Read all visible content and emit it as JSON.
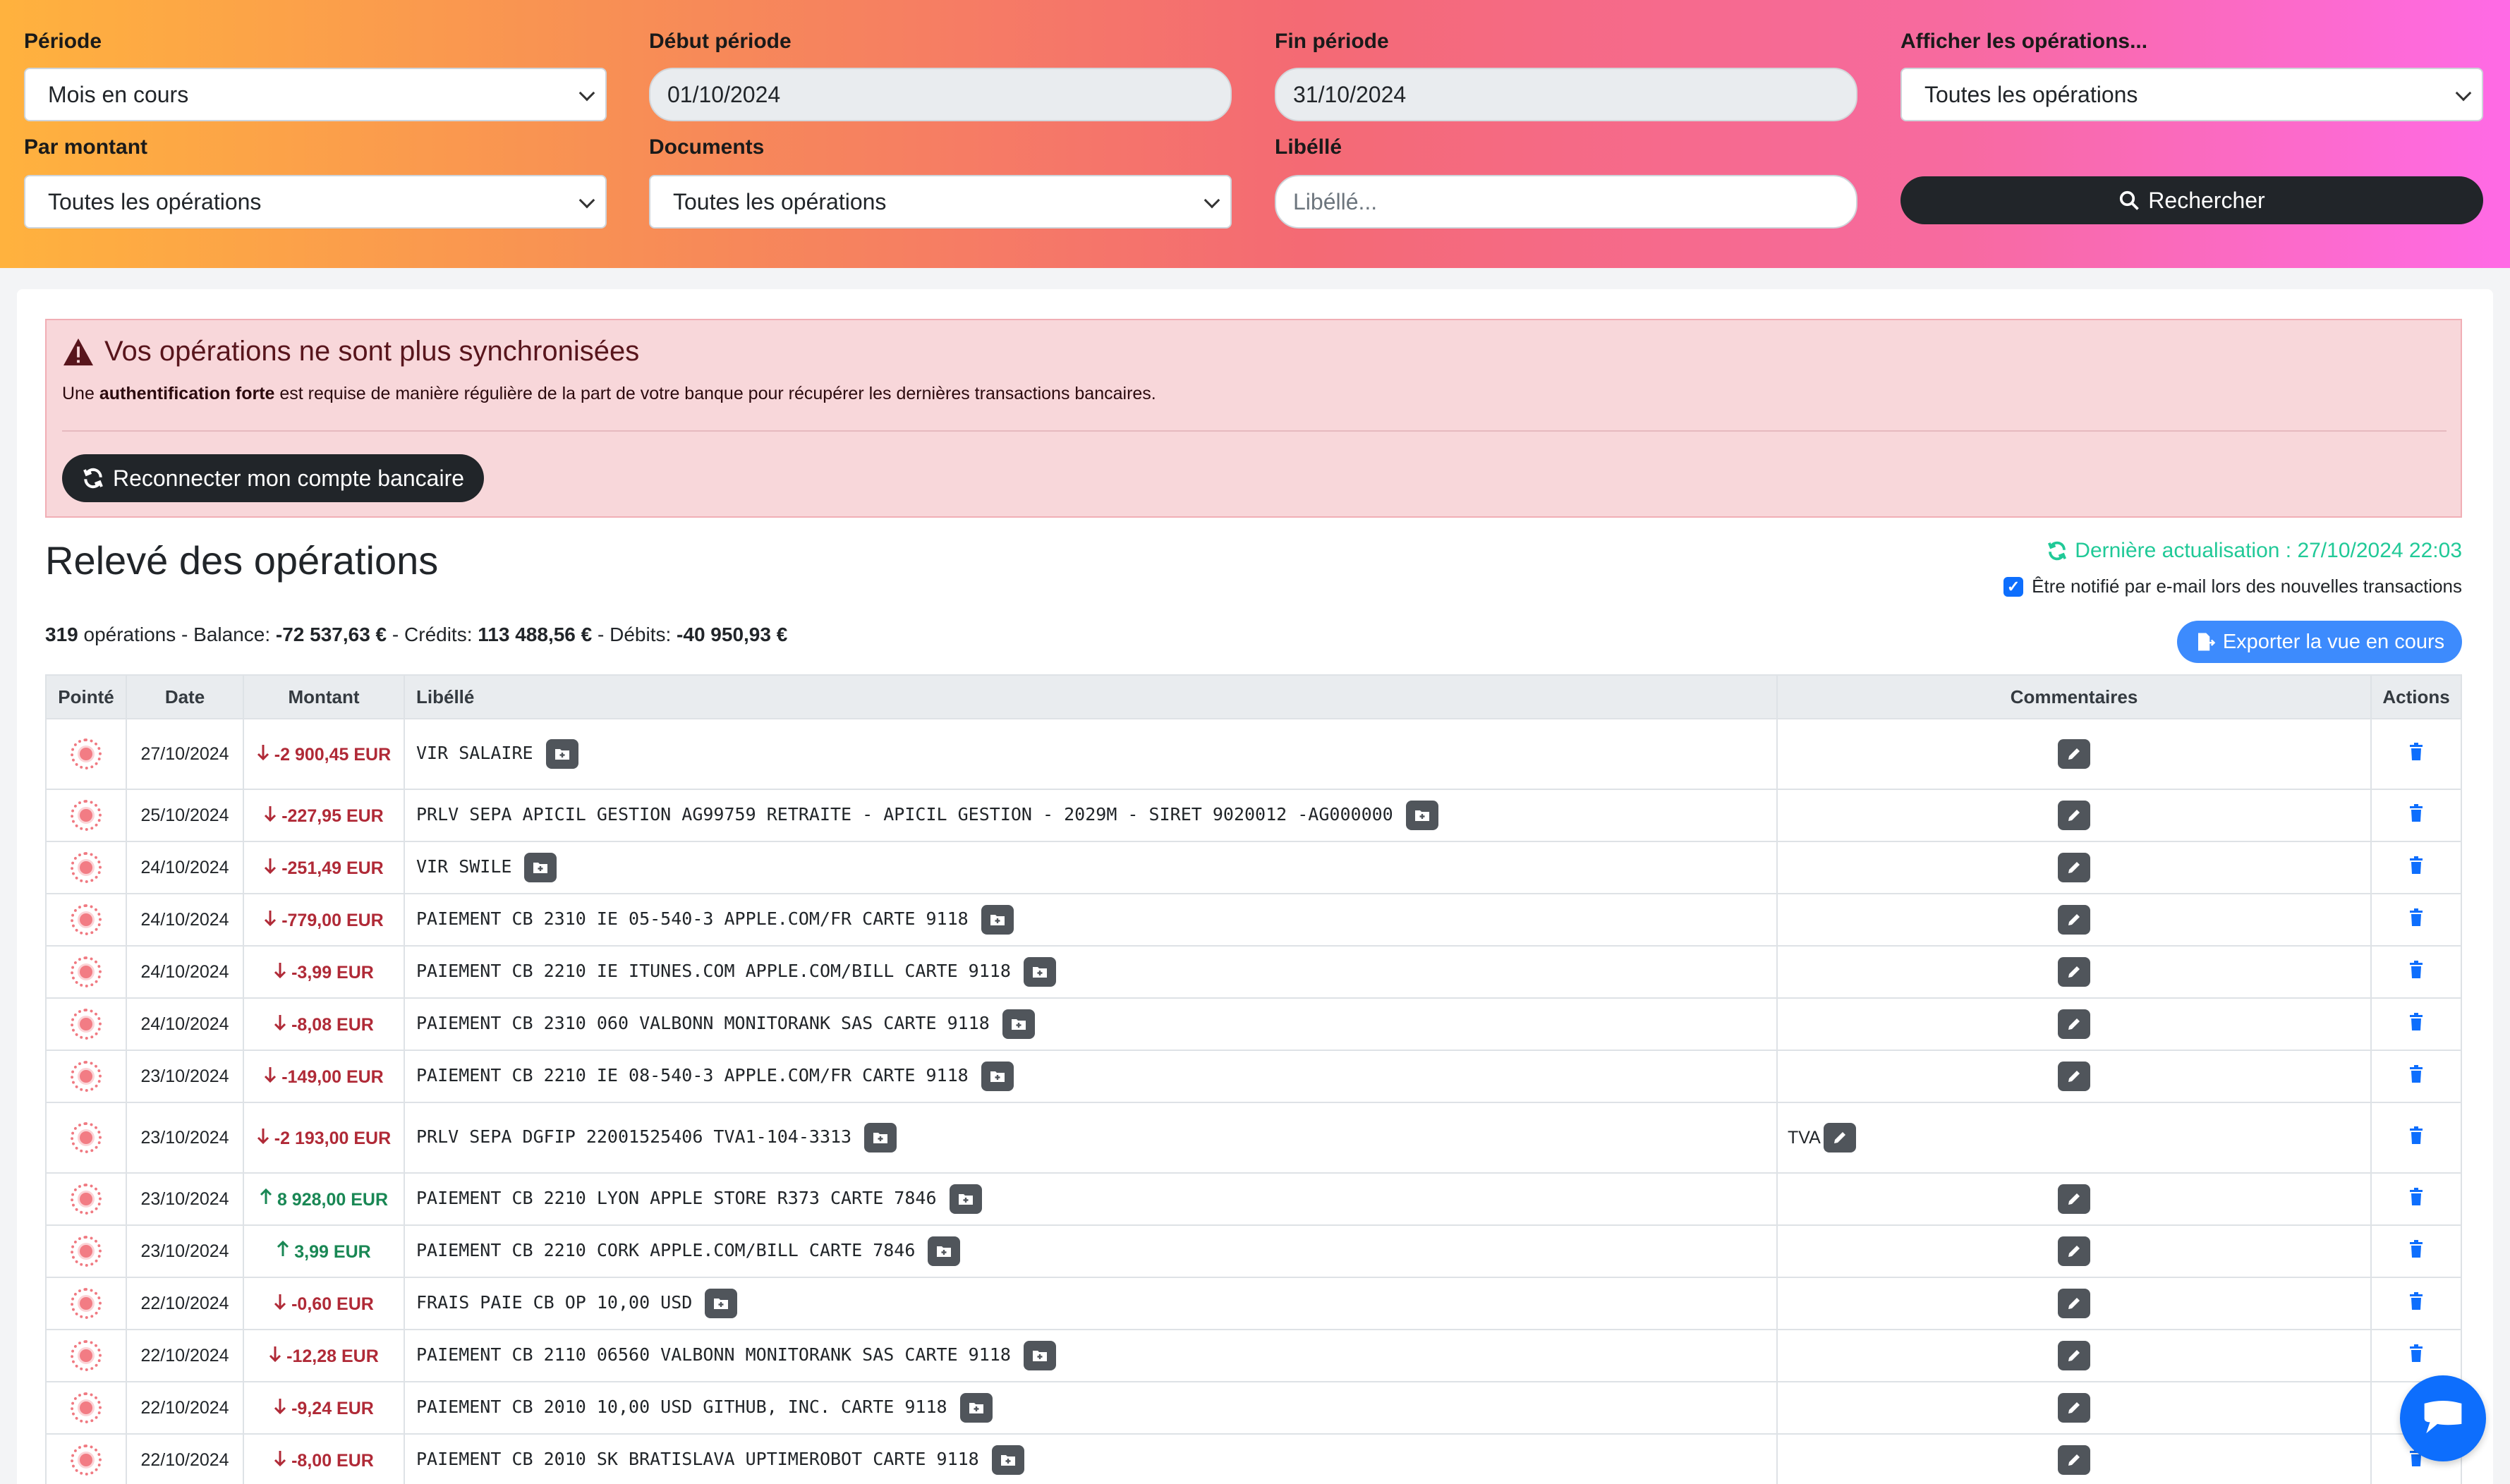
{
  "filters": {
    "periode": {
      "label": "Période",
      "value": "Mois en cours"
    },
    "debut": {
      "label": "Début période",
      "value": "01/10/2024"
    },
    "fin": {
      "label": "Fin période",
      "value": "31/10/2024"
    },
    "afficher": {
      "label": "Afficher les opérations...",
      "value": "Toutes les opérations"
    },
    "montant": {
      "label": "Par montant",
      "value": "Toutes les opérations"
    },
    "documents": {
      "label": "Documents",
      "value": "Toutes les opérations"
    },
    "libelle": {
      "label": "Libéllé",
      "placeholder": "Libéllé..."
    },
    "search_label": "Rechercher"
  },
  "alert": {
    "title": "Vos opérations ne sont plus synchronisées",
    "text_before": "Une ",
    "text_bold": "authentification forte",
    "text_after": " est requise de manière régulière de la part de votre banque pour récupérer les dernières transactions bancaires.",
    "button_label": "Reconnecter mon compte bancaire"
  },
  "header": {
    "title": "Relevé des opérations",
    "last_update": "Dernière actualisation : 27/10/2024 22:03",
    "notify_label": "Être notifié par e-mail lors des nouvelles transactions",
    "export_label": "Exporter la vue en cours"
  },
  "summary": {
    "count": "319",
    "count_suffix": " opérations - Balance: ",
    "balance": "-72 537,63 €",
    "credits_label": " - Crédits: ",
    "credits": "113 488,56 €",
    "debits_label": " - Débits: ",
    "debits": "-40 950,93 €"
  },
  "table": {
    "columns": [
      "Pointé",
      "Date",
      "Montant",
      "Libéllé",
      "Commentaires",
      "Actions"
    ],
    "rows": [
      {
        "date": "27/10/2024",
        "amount": "-2 900,45",
        "currency": "EUR",
        "direction": "debit",
        "label": "VIR SALAIRE",
        "comment": ""
      },
      {
        "date": "25/10/2024",
        "amount": "-227,95",
        "currency": "EUR",
        "direction": "debit",
        "label": "PRLV SEPA APICIL GESTION AG99759 RETRAITE - APICIL GESTION - 2029M - SIRET 9020012 -AG000000",
        "comment": ""
      },
      {
        "date": "24/10/2024",
        "amount": "-251,49",
        "currency": "EUR",
        "direction": "debit",
        "label": "VIR SWILE",
        "comment": ""
      },
      {
        "date": "24/10/2024",
        "amount": "-779,00",
        "currency": "EUR",
        "direction": "debit",
        "label": "PAIEMENT CB 2310 IE 05-540-3 APPLE.COM/FR CARTE 9118",
        "comment": ""
      },
      {
        "date": "24/10/2024",
        "amount": "-3,99",
        "currency": "EUR",
        "direction": "debit",
        "label": "PAIEMENT CB 2210 IE ITUNES.COM APPLE.COM/BILL CARTE 9118",
        "comment": ""
      },
      {
        "date": "24/10/2024",
        "amount": "-8,08",
        "currency": "EUR",
        "direction": "debit",
        "label": "PAIEMENT CB 2310 060 VALBONN MONITORANK SAS CARTE 9118",
        "comment": ""
      },
      {
        "date": "23/10/2024",
        "amount": "-149,00",
        "currency": "EUR",
        "direction": "debit",
        "label": "PAIEMENT CB 2210 IE 08-540-3 APPLE.COM/FR CARTE 9118",
        "comment": ""
      },
      {
        "date": "23/10/2024",
        "amount": "-2 193,00",
        "currency": "EUR",
        "direction": "debit",
        "label": "PRLV SEPA DGFIP 22001525406 TVA1-104-3313",
        "comment": "TVA"
      },
      {
        "date": "23/10/2024",
        "amount": "8 928,00",
        "currency": "EUR",
        "direction": "credit",
        "label": "PAIEMENT CB 2210 LYON APPLE STORE R373 CARTE 7846",
        "comment": ""
      },
      {
        "date": "23/10/2024",
        "amount": "3,99",
        "currency": "EUR",
        "direction": "credit",
        "label": "PAIEMENT CB 2210 CORK APPLE.COM/BILL CARTE 7846",
        "comment": ""
      },
      {
        "date": "22/10/2024",
        "amount": "-0,60",
        "currency": "EUR",
        "direction": "debit",
        "label": "FRAIS PAIE CB OP 10,00 USD",
        "comment": ""
      },
      {
        "date": "22/10/2024",
        "amount": "-12,28",
        "currency": "EUR",
        "direction": "debit",
        "label": "PAIEMENT CB 2110 06560 VALBONN MONITORANK SAS CARTE 9118",
        "comment": ""
      },
      {
        "date": "22/10/2024",
        "amount": "-9,24",
        "currency": "EUR",
        "direction": "debit",
        "label": "PAIEMENT CB 2010 10,00 USD GITHUB, INC. CARTE 9118",
        "comment": ""
      },
      {
        "date": "22/10/2024",
        "amount": "-8,00",
        "currency": "EUR",
        "direction": "debit",
        "label": "PAIEMENT CB 2010 SK BRATISLAVA UPTIMEROBOT CARTE 9118",
        "comment": ""
      }
    ]
  },
  "colors": {
    "debit": "#b02a37",
    "credit": "#198754",
    "accent": "#0d6efd",
    "teal": "#20c997"
  }
}
